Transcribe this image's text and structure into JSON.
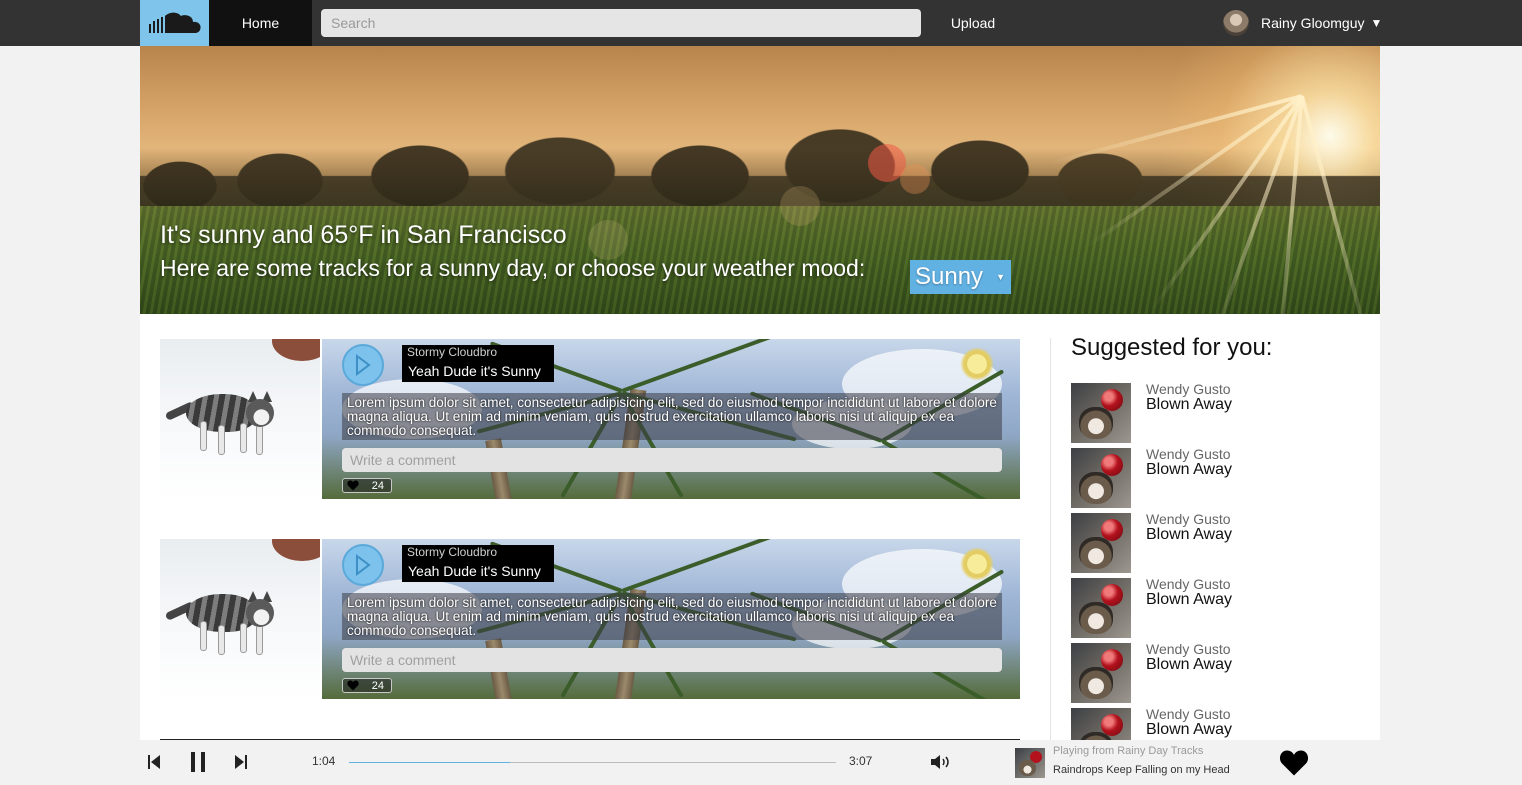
{
  "nav": {
    "home_label": "Home",
    "search_placeholder": "Search",
    "upload_label": "Upload",
    "user_name": "Rainy Gloomguy",
    "user_caret": "▼"
  },
  "hero": {
    "line1": "It's sunny and 65°F in San Francisco",
    "line2": "Here are some tracks for a sunny day, or choose your weather mood:",
    "mood_selected": "Sunny",
    "mood_caret": "▼"
  },
  "tracks": [
    {
      "artist": "Stormy Cloudbro",
      "title": "Yeah Dude it's Sunny",
      "description": "Lorem ipsum dolor sit amet, consectetur adipisicing elit, sed do eiusmod tempor incididunt ut labore et dolore magna aliqua. Ut enim ad minim veniam, quis nostrud exercitation ullamco laboris nisi ut aliquip ex ea commodo consequat.",
      "comment_placeholder": "Write a comment",
      "likes": "24"
    },
    {
      "artist": "Stormy Cloudbro",
      "title": "Yeah Dude it's Sunny",
      "description": "Lorem ipsum dolor sit amet, consectetur adipisicing elit, sed do eiusmod tempor incididunt ut labore et dolore magna aliqua. Ut enim ad minim veniam, quis nostrud exercitation ullamco laboris nisi ut aliquip ex ea commodo consequat.",
      "comment_placeholder": "Write a comment",
      "likes": "24"
    }
  ],
  "sidebar": {
    "title": "Suggested for you:",
    "items": [
      {
        "artist": "Wendy Gusto",
        "title": "Blown Away"
      },
      {
        "artist": "Wendy Gusto",
        "title": "Blown Away"
      },
      {
        "artist": "Wendy Gusto",
        "title": "Blown Away"
      },
      {
        "artist": "Wendy Gusto",
        "title": "Blown Away"
      },
      {
        "artist": "Wendy Gusto",
        "title": "Blown Away"
      },
      {
        "artist": "Wendy Gusto",
        "title": "Blown Away"
      }
    ]
  },
  "player": {
    "elapsed": "1:04",
    "duration": "3:07",
    "progress_fraction": 0.33,
    "context": "Playing from Rainy Day Tracks",
    "now_playing_title": "Raindrops Keep Falling on my Head"
  },
  "colors": {
    "accent": "#62b1e3",
    "topbar": "#333333",
    "logo_bg": "#7fc4ea"
  },
  "icons": [
    "soundcloud-logo-icon",
    "play-icon",
    "sun-weather-icon",
    "heart-icon",
    "previous-icon",
    "pause-icon",
    "next-icon",
    "volume-icon"
  ]
}
